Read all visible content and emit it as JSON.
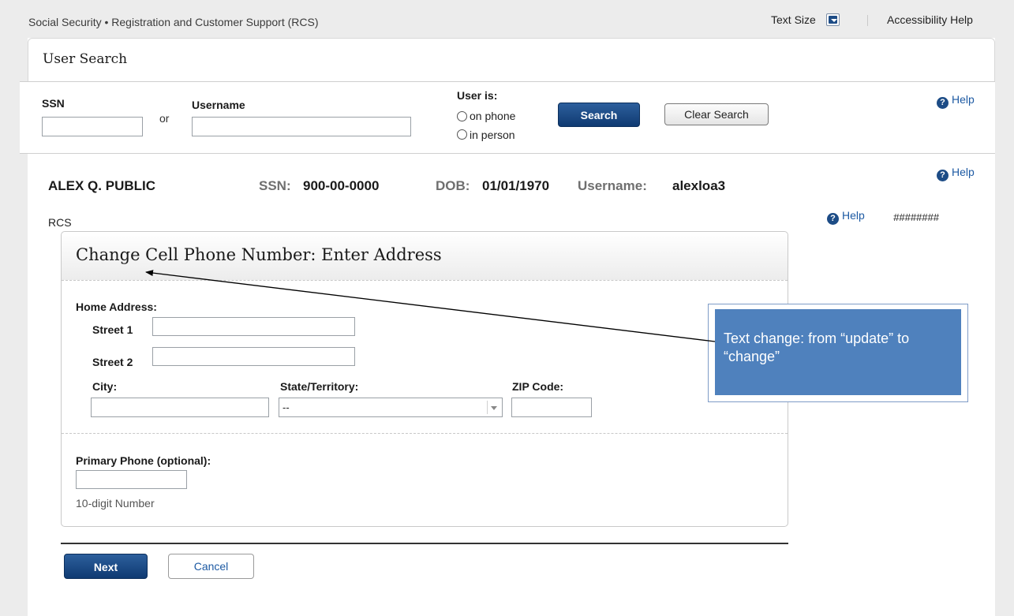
{
  "topbar": {
    "title": "Social Security • Registration and Customer Support (RCS)",
    "text_size": "Text Size",
    "accessibility_help": "Accessibility Help"
  },
  "user_search": {
    "title": "User Search",
    "ssn_label": "SSN",
    "or": "or",
    "username_label": "Username",
    "user_is_label": "User is:",
    "on_phone": "on phone",
    "in_person": "in person",
    "search_button": "Search",
    "clear_search_button": "Clear Search",
    "help": "Help"
  },
  "user_details": {
    "name": "ALEX Q. PUBLIC",
    "ssn_label": "SSN:",
    "ssn": "900-00-0000",
    "dob_label": "DOB:",
    "dob": "01/01/1970",
    "username_label": "Username:",
    "username": "alexloa3",
    "help": "Help"
  },
  "rcs": {
    "label": "RCS",
    "help": "Help",
    "code": "########"
  },
  "form": {
    "title": "Change Cell Phone Number: Enter Address",
    "home_address": "Home Address:",
    "street1": "Street 1",
    "street2": "Street 2",
    "city": "City:",
    "state": "State/Territory:",
    "state_value": "--",
    "zip": "ZIP Code:",
    "primary_phone": "Primary Phone (optional):",
    "phone_hint": "10-digit Number"
  },
  "actions": {
    "next": "Next",
    "cancel": "Cancel"
  },
  "annotation": {
    "text": "Text change: from “update” to “change”",
    "fill_color": "#4f81bd"
  }
}
